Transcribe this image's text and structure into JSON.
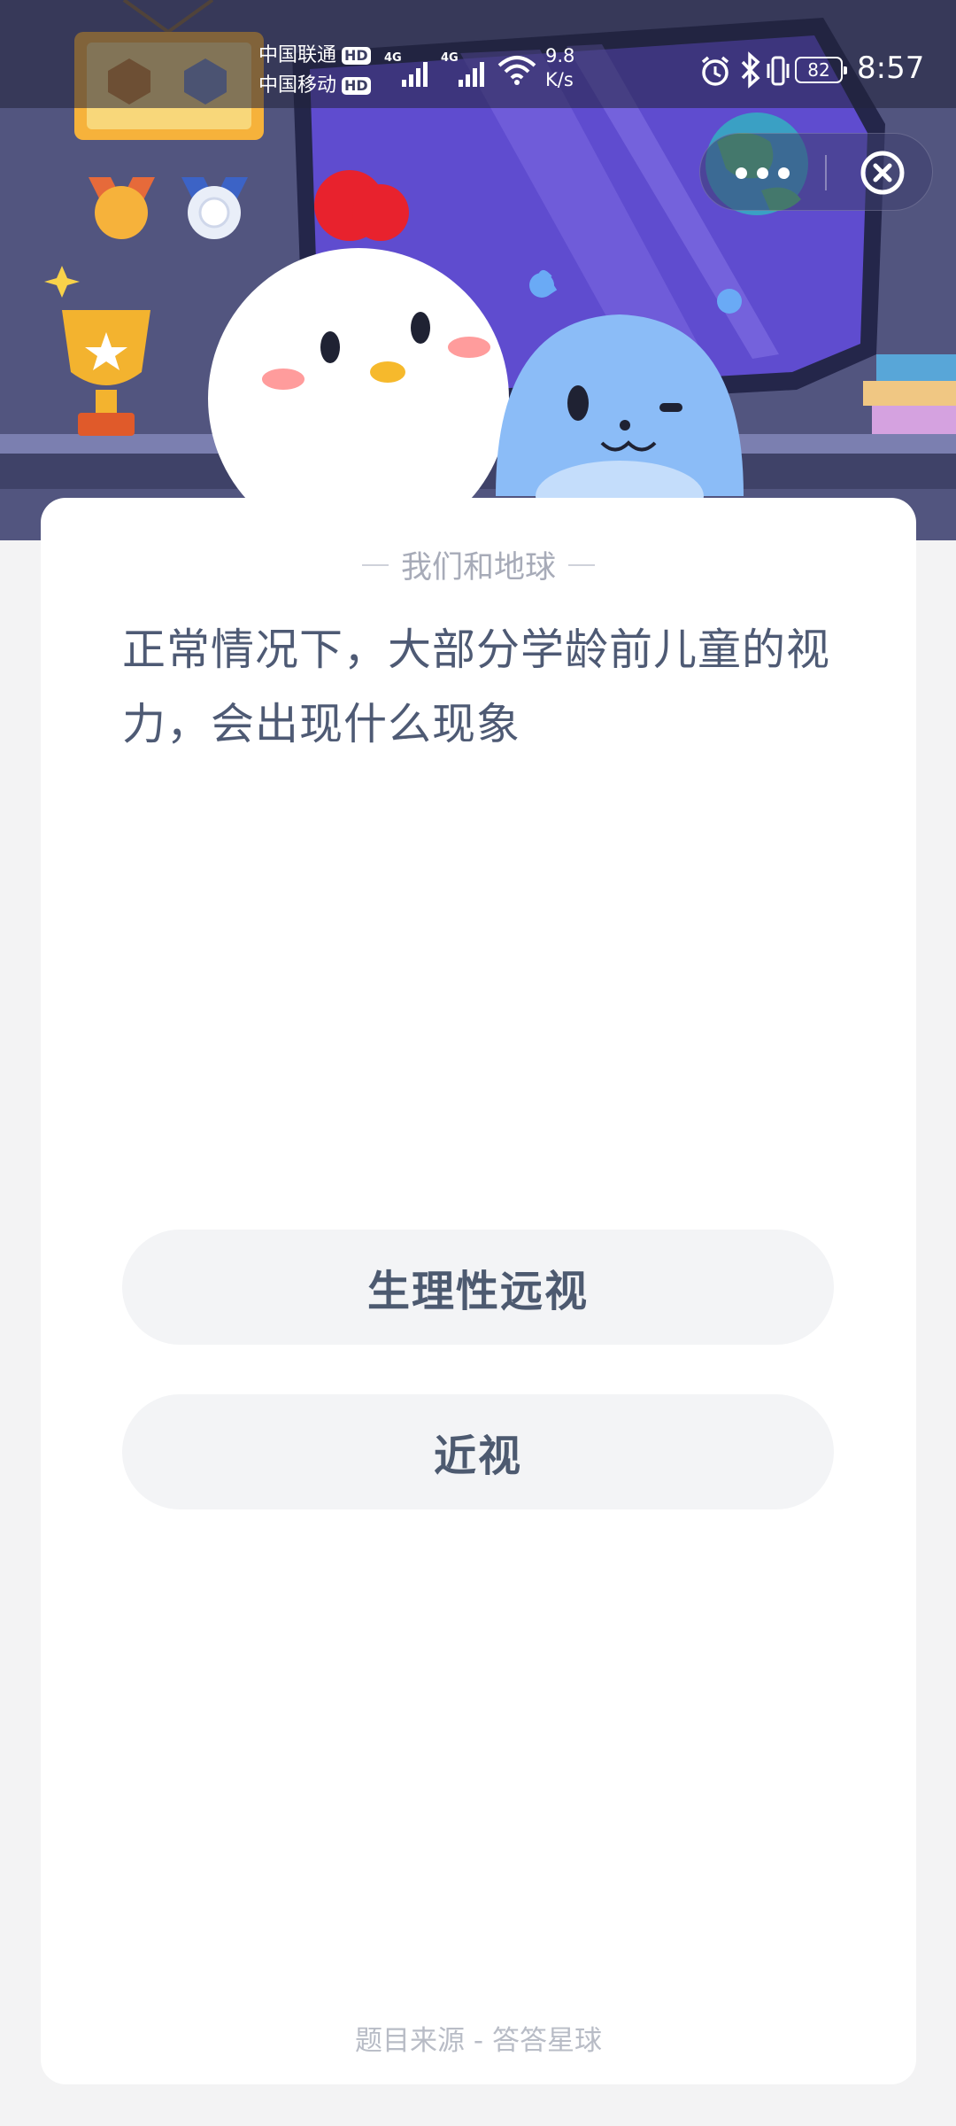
{
  "status_bar": {
    "carrier_1": "中国联通",
    "carrier_2": "中国移动",
    "hd_badge": "HD",
    "network_tag": "4G",
    "speed_value": "9.8",
    "speed_unit": "K/s",
    "battery": "82",
    "time": "8:57",
    "icons": [
      "signal-icon",
      "wifi-icon",
      "alarm-icon",
      "bluetooth-icon",
      "vibrate-icon",
      "battery-icon"
    ]
  },
  "capsule": {
    "icons": [
      "more-dots-icon",
      "close-circle-icon"
    ]
  },
  "quiz": {
    "category": "我们和地球",
    "question": "正常情况下，大部分学龄前儿童的视力，会出现什么现象",
    "options": [
      {
        "label": "生理性远视"
      },
      {
        "label": "近视"
      }
    ],
    "source": "题目来源 - 答答星球"
  },
  "colors": {
    "hero_bg": "#52557f",
    "page_bg": "#f3f3f4",
    "question_text": "#4e5a74",
    "option_bg": "#f3f4f6",
    "muted_text": "#a7abb8"
  }
}
